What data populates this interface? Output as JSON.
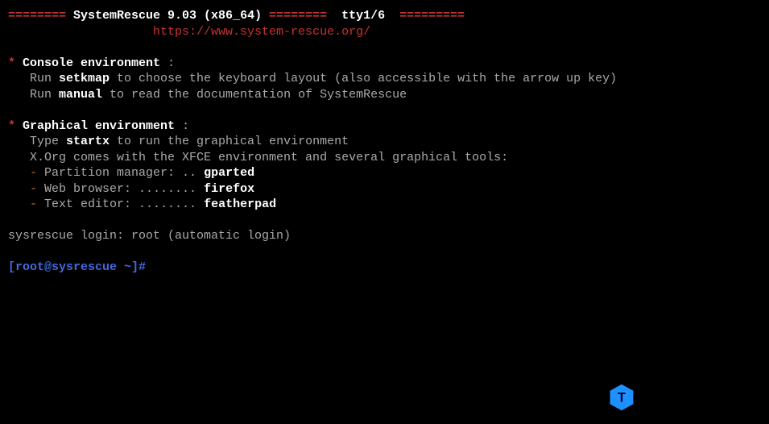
{
  "header": {
    "eq1": "========",
    "title": "SystemRescue 9.03 (x86_64)",
    "eq2": "========",
    "tty": "tty1/6",
    "eq3": "=========",
    "url": "https://www.system-rescue.org/"
  },
  "console": {
    "bullet": "*",
    "title": "Console environment",
    "colon": " :",
    "line1a": "   Run ",
    "line1cmd": "setkmap",
    "line1b": " to choose the keyboard layout (also accessible with the arrow up key)",
    "line2a": "   Run ",
    "line2cmd": "manual",
    "line2b": " to read the documentation of SystemRescue"
  },
  "graphical": {
    "bullet": "*",
    "title": "Graphical environment",
    "colon": " :",
    "line1a": "   Type ",
    "line1cmd": "startx",
    "line1b": " to run the graphical environment",
    "line2": "   X.Org comes with the XFCE environment and several graphical tools:",
    "dash": "-",
    "tool1a": " Partition manager: .. ",
    "tool1b": "gparted",
    "tool2a": " Web browser: ........ ",
    "tool2b": "firefox",
    "tool3a": " Text editor: ........ ",
    "tool3b": "featherpad"
  },
  "login": {
    "text": "sysrescue login: root (automatic login)"
  },
  "prompt": {
    "text": "[root@sysrescue ~]#"
  },
  "badge": {
    "letter": "T"
  }
}
